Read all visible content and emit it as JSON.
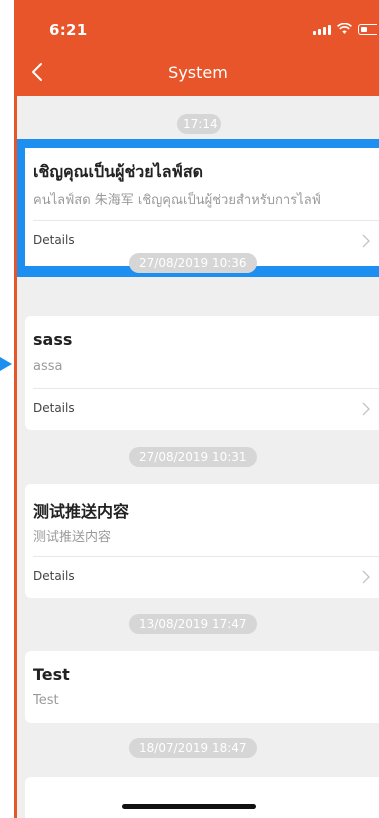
{
  "status_bar": {
    "time": "6:21"
  },
  "nav": {
    "title": "System",
    "back_icon": "chevron-left-icon"
  },
  "messages": [
    {
      "timestamp": "17:14",
      "title": "เชิญคุณเป็นผู้ช่วยไลฟ์สด",
      "body": "คนไลฟ์สด 朱海军 เชิญคุณเป็นผู้ช่วยสำหรับการไลฟ์",
      "details_label": "Details",
      "highlighted": true
    },
    {
      "timestamp": "27/08/2019 10:36",
      "title": "sass",
      "body": "assa",
      "details_label": "Details"
    },
    {
      "timestamp": "27/08/2019 10:31",
      "title": "测试推送内容",
      "body": "测试推送内容",
      "details_label": "Details"
    },
    {
      "timestamp": "13/08/2019 17:47",
      "title": "Test",
      "body": "Test"
    },
    {
      "timestamp": "18/07/2019 18:47"
    }
  ],
  "colors": {
    "header": "#e8552a",
    "highlight": "#1d8ff0",
    "background": "#efefef"
  }
}
